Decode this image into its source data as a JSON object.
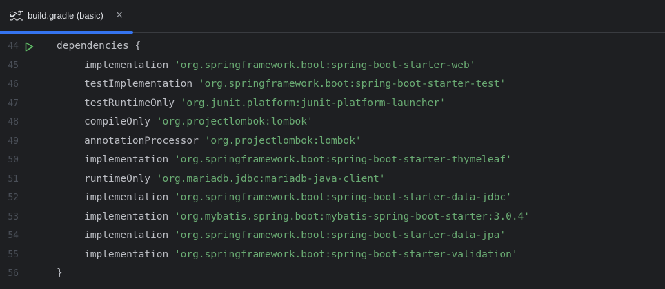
{
  "tab": {
    "label": "build.gradle (basic)",
    "icon": "gradle-elephant-icon",
    "close_glyph": "×",
    "accent": "#3574f0"
  },
  "colors": {
    "background": "#1e1f22",
    "string": "#6aab73",
    "identifier": "#bcbec4",
    "line_number": "#4b5059",
    "run_icon": "#5fb865"
  },
  "editor": {
    "lines": [
      {
        "num": "44",
        "indent": false,
        "ident": "dependencies",
        "str": "",
        "brace": " {",
        "run": true
      },
      {
        "num": "45",
        "indent": true,
        "ident": "implementation ",
        "str": "'org.springframework.boot:spring-boot-starter-web'",
        "brace": "",
        "run": false
      },
      {
        "num": "46",
        "indent": true,
        "ident": "testImplementation ",
        "str": "'org.springframework.boot:spring-boot-starter-test'",
        "brace": "",
        "run": false
      },
      {
        "num": "47",
        "indent": true,
        "ident": "testRuntimeOnly ",
        "str": "'org.junit.platform:junit-platform-launcher'",
        "brace": "",
        "run": false
      },
      {
        "num": "48",
        "indent": true,
        "ident": "compileOnly ",
        "str": "'org.projectlombok:lombok'",
        "brace": "",
        "run": false
      },
      {
        "num": "49",
        "indent": true,
        "ident": "annotationProcessor ",
        "str": "'org.projectlombok:lombok'",
        "brace": "",
        "run": false
      },
      {
        "num": "50",
        "indent": true,
        "ident": "implementation ",
        "str": "'org.springframework.boot:spring-boot-starter-thymeleaf'",
        "brace": "",
        "run": false
      },
      {
        "num": "51",
        "indent": true,
        "ident": "runtimeOnly ",
        "str": "'org.mariadb.jdbc:mariadb-java-client'",
        "brace": "",
        "run": false
      },
      {
        "num": "52",
        "indent": true,
        "ident": "implementation ",
        "str": "'org.springframework.boot:spring-boot-starter-data-jdbc'",
        "brace": "",
        "run": false
      },
      {
        "num": "53",
        "indent": true,
        "ident": "implementation ",
        "str": "'org.mybatis.spring.boot:mybatis-spring-boot-starter:3.0.4'",
        "brace": "",
        "run": false
      },
      {
        "num": "54",
        "indent": true,
        "ident": "implementation ",
        "str": "'org.springframework.boot:spring-boot-starter-data-jpa'",
        "brace": "",
        "run": false
      },
      {
        "num": "55",
        "indent": true,
        "ident": "implementation ",
        "str": "'org.springframework.boot:spring-boot-starter-validation'",
        "brace": "",
        "run": false
      },
      {
        "num": "56",
        "indent": false,
        "ident": "",
        "str": "",
        "brace": "}",
        "run": false
      }
    ]
  }
}
